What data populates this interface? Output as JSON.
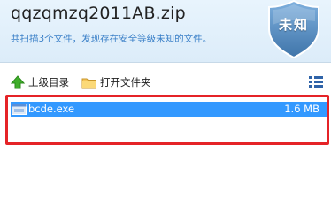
{
  "header": {
    "title": "qqzqmzq2011AB.zip",
    "subtitle": "共扫描3个文件，发现存在安全等级未知的文件。",
    "badge_label": "未知",
    "badge_color": "#5a8fc2"
  },
  "toolbar": {
    "up_label": "上级目录",
    "open_folder_label": "打开文件夹"
  },
  "file_list": {
    "rows": [
      {
        "name": "bcde.exe",
        "size": "1.6 MB",
        "selected": true
      }
    ],
    "highlight_color": "#e52327",
    "selection_color": "#3399ff"
  }
}
